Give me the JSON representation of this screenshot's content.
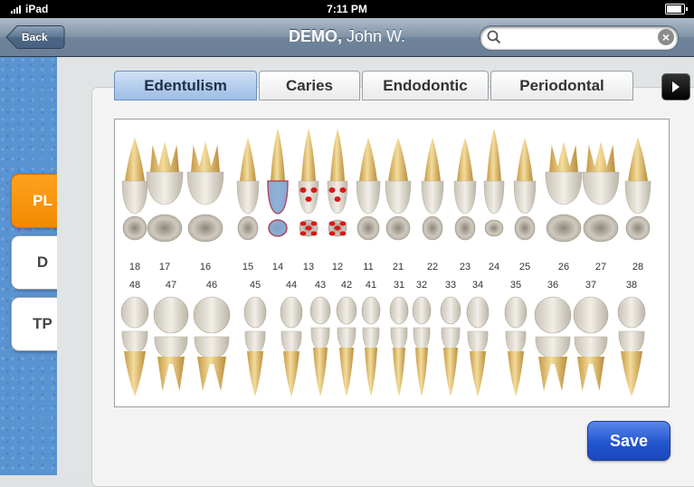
{
  "status": {
    "carrier": "iPad",
    "time": "7:11 PM"
  },
  "nav": {
    "back_label": "Back",
    "patient_last": "DEMO,",
    "patient_first": "John W.",
    "search_value": ""
  },
  "side_buttons": [
    {
      "label": "PL",
      "active": true
    },
    {
      "label": "D",
      "active": false
    },
    {
      "label": "TP",
      "active": false
    }
  ],
  "tabs": [
    {
      "label": "Edentulism",
      "active": true
    },
    {
      "label": "Caries",
      "active": false
    },
    {
      "label": "Endodontic",
      "active": false
    },
    {
      "label": "Periodontal",
      "active": false
    }
  ],
  "upper_teeth": [
    "18",
    "17",
    "16",
    "15",
    "14",
    "13",
    "12",
    "11",
    "21",
    "22",
    "23",
    "24",
    "25",
    "26",
    "27",
    "28"
  ],
  "lower_teeth": [
    "48",
    "47",
    "46",
    "45",
    "44",
    "43",
    "42",
    "41",
    "31",
    "32",
    "33",
    "34",
    "35",
    "36",
    "37",
    "38"
  ],
  "highlights": {
    "edentulism": [
      "14"
    ],
    "caries": [
      "13",
      "12"
    ],
    "edentulism_color": "#7fa6d6",
    "caries_color": "#d81818"
  },
  "save_label": "Save"
}
